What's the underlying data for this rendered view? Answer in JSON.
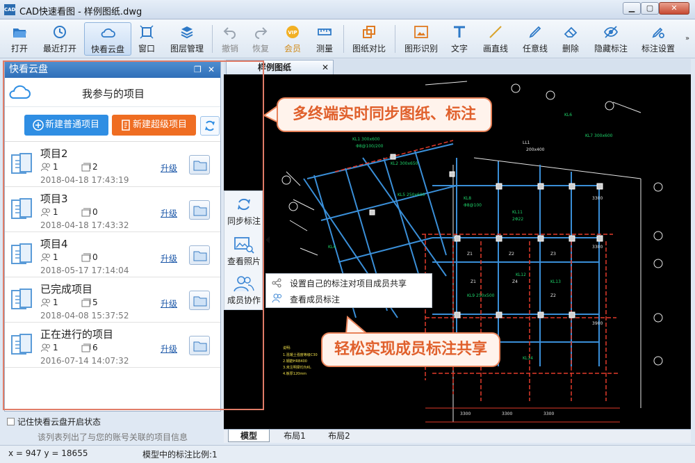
{
  "window": {
    "title": "CAD快速看图 - 样例图纸.dwg",
    "logo_text": "CAD"
  },
  "toolbar": {
    "buttons": [
      {
        "label": "打开",
        "icon": "folder-open-icon"
      },
      {
        "label": "最近打开",
        "icon": "clock-icon"
      },
      {
        "label": "快看云盘",
        "icon": "cloud-icon",
        "active": true
      },
      {
        "label": "窗口",
        "icon": "window-icon"
      },
      {
        "label": "图层管理",
        "icon": "layers-icon"
      },
      {
        "label": "撤销",
        "icon": "undo-icon",
        "disabled": true
      },
      {
        "label": "恢复",
        "icon": "redo-icon",
        "disabled": true
      },
      {
        "label": "会员",
        "icon": "vip-icon"
      },
      {
        "label": "测量",
        "icon": "ruler-icon"
      },
      {
        "label": "图纸对比",
        "icon": "compare-icon"
      },
      {
        "label": "图形识别",
        "icon": "shape-recognize-icon"
      },
      {
        "label": "文字",
        "icon": "text-icon"
      },
      {
        "label": "画直线",
        "icon": "line-icon"
      },
      {
        "label": "任意线",
        "icon": "pen-icon"
      },
      {
        "label": "删除",
        "icon": "eraser-icon"
      },
      {
        "label": "隐藏标注",
        "icon": "eye-hide-icon"
      },
      {
        "label": "标注设置",
        "icon": "settings-icon"
      }
    ],
    "more": "»"
  },
  "panel": {
    "title": "快看云盘",
    "section_title": "我参与的项目",
    "new_normal_label": "新建普通项目",
    "new_super_label": "新建超级项目",
    "upgrade_label": "升级",
    "projects": [
      {
        "name": "项目2",
        "members": "1",
        "files": "2",
        "time": "2018-04-18 17:43:19"
      },
      {
        "name": "项目3",
        "members": "1",
        "files": "0",
        "time": "2018-04-18 17:43:32"
      },
      {
        "name": "项目4",
        "members": "1",
        "files": "0",
        "time": "2018-05-17 17:14:04"
      },
      {
        "name": "已完成项目",
        "members": "1",
        "files": "5",
        "time": "2018-04-08 15:37:52"
      },
      {
        "name": "正在进行的项目",
        "members": "1",
        "files": "6",
        "time": "2016-07-14 14:07:32"
      }
    ],
    "remember_label": "记住快看云盘开启状态",
    "hint": "该列表列出了与您的账号关联的项目信息"
  },
  "document": {
    "tab_title": "样例图纸"
  },
  "side_tools": [
    {
      "label": "同步标注",
      "icon": "sync-icon"
    },
    {
      "label": "查看照片",
      "icon": "photo-search-icon"
    },
    {
      "label": "成员协作",
      "icon": "members-icon"
    }
  ],
  "popup_menu": [
    {
      "label": "设置自己的标注对项目成员共享",
      "icon": "share-icon"
    },
    {
      "label": "查看成员标注",
      "icon": "members-icon"
    }
  ],
  "callouts": {
    "top": "多终端实时同步图纸、标注",
    "bottom": "轻松实现成员标注共享"
  },
  "layout_tabs": [
    "模型",
    "布局1",
    "布局2"
  ],
  "status": {
    "coords": "x = 947  y = 18655",
    "scale": "模型中的标注比例:1"
  },
  "colors": {
    "accent_blue": "#2f8ee3",
    "accent_orange": "#ef6d22",
    "callout_border": "#e88259",
    "canvas_bg": "#000000"
  }
}
